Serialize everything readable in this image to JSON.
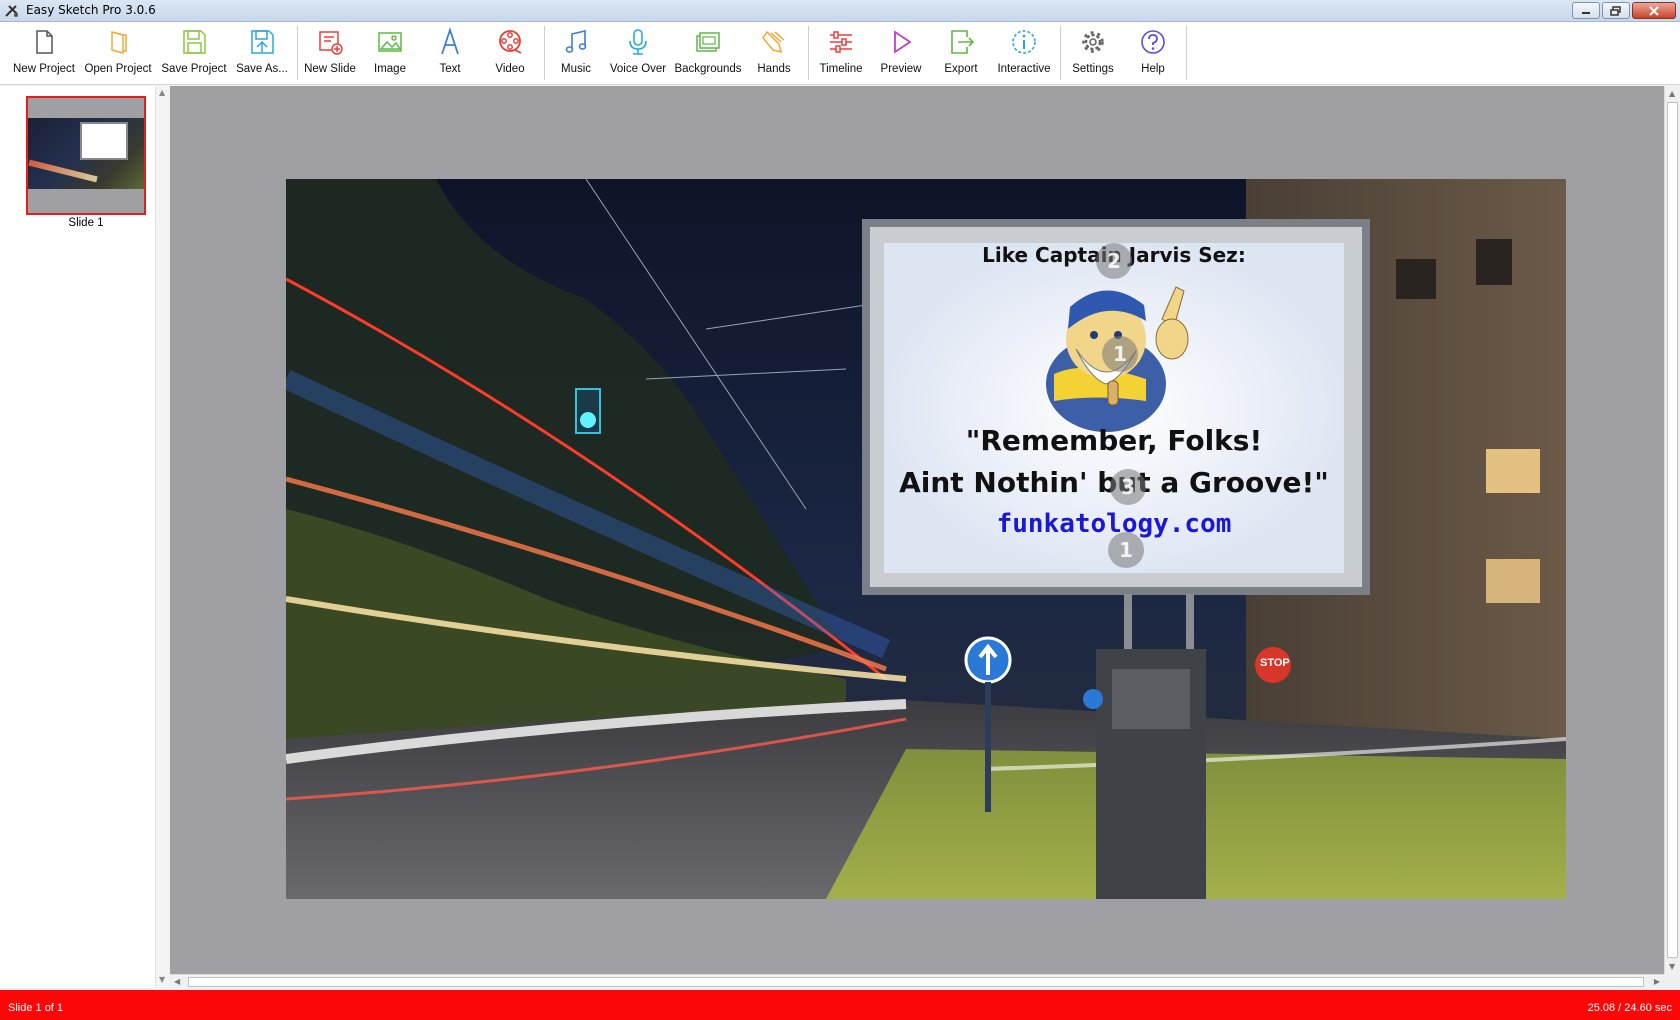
{
  "window": {
    "title": "Easy Sketch Pro 3.0.6"
  },
  "toolbar": {
    "items": [
      {
        "id": "new-project",
        "label": "New Project",
        "icon": "document-icon",
        "color": "#555555"
      },
      {
        "id": "open-project",
        "label": "Open Project",
        "icon": "open-folder-icon",
        "color": "#f0a830"
      },
      {
        "id": "save-project",
        "label": "Save Project",
        "icon": "save-icon",
        "color": "#8dc63f"
      },
      {
        "id": "save-as",
        "label": "Save As...",
        "icon": "save-as-icon",
        "color": "#29a8e0"
      },
      {
        "id": "new-slide",
        "label": "New Slide",
        "icon": "new-slide-icon",
        "color": "#e8413b"
      },
      {
        "id": "image",
        "label": "Image",
        "icon": "image-icon",
        "color": "#5fb848"
      },
      {
        "id": "text",
        "label": "Text",
        "icon": "text-icon",
        "color": "#3a7fd5"
      },
      {
        "id": "video",
        "label": "Video",
        "icon": "film-reel-icon",
        "color": "#e8413b"
      },
      {
        "id": "music",
        "label": "Music",
        "icon": "music-note-icon",
        "color": "#3a7fd5"
      },
      {
        "id": "voice-over",
        "label": "Voice Over",
        "icon": "microphone-icon",
        "color": "#29a8e0"
      },
      {
        "id": "backgrounds",
        "label": "Backgrounds",
        "icon": "backgrounds-icon",
        "color": "#5fb848"
      },
      {
        "id": "hands",
        "label": "Hands",
        "icon": "hand-icon",
        "color": "#f0a830"
      },
      {
        "id": "timeline",
        "label": "Timeline",
        "icon": "timeline-icon",
        "color": "#e8413b"
      },
      {
        "id": "preview",
        "label": "Preview",
        "icon": "play-icon",
        "color": "#c03ec8"
      },
      {
        "id": "export",
        "label": "Export",
        "icon": "export-icon",
        "color": "#5fb848"
      },
      {
        "id": "interactive",
        "label": "Interactive",
        "icon": "info-icon",
        "color": "#29a8e0"
      },
      {
        "id": "settings",
        "label": "Settings",
        "icon": "gear-icon",
        "color": "#666666"
      },
      {
        "id": "help",
        "label": "Help",
        "icon": "help-icon",
        "color": "#5a4fd6"
      }
    ]
  },
  "slides": [
    {
      "label": "Slide 1",
      "selected": true
    }
  ],
  "stage": {
    "billboard": {
      "heading": "Like Captain Jarvis Sez:",
      "quote_line1": "\"Remember, Folks!",
      "quote_line2": "Aint Nothin' but a Groove!\"",
      "url": "funkatology.com"
    },
    "markers": [
      "2",
      "1",
      "3",
      "1"
    ],
    "road_sign": "STOP"
  },
  "status": {
    "left": "Slide 1 of 1",
    "right": "25.08 / 24.60 sec"
  },
  "colors": {
    "status_bar": "#fb0707",
    "selection": "#e1201b",
    "canvas_bg": "#a0a0a4",
    "url": "#1a17d6"
  }
}
